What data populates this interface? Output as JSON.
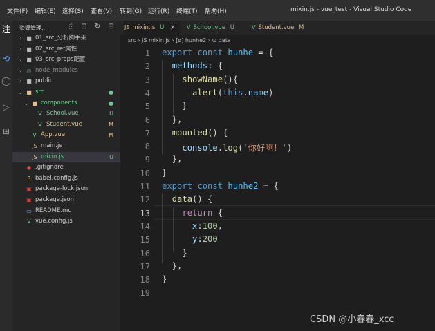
{
  "menu": [
    "文件(F)",
    "编辑(E)",
    "选择(S)",
    "查看(V)",
    "转到(G)",
    "运行(R)",
    "终端(T)",
    "帮助(H)"
  ],
  "window_title": "mixin.js - vue_test - Visual Studio Code",
  "activity": {
    "top_label": "注"
  },
  "sidebar": {
    "title": "资源管理...",
    "tools": "⎘ ⊡ ↻ ⊟ ···",
    "items": [
      {
        "label": "01_src_分析脚手架",
        "arrow": "›",
        "icon": "■",
        "status": ""
      },
      {
        "label": "02_src_ref属性",
        "arrow": "›",
        "icon": "■",
        "status": ""
      },
      {
        "label": "03_src_props配置",
        "arrow": "›",
        "icon": "■",
        "status": ""
      },
      {
        "label": "node_modules",
        "arrow": "›",
        "icon": "◎",
        "status": ""
      },
      {
        "label": "public",
        "arrow": "›",
        "icon": "■",
        "status": ""
      },
      {
        "label": "src",
        "arrow": "⌄",
        "icon": "■",
        "status": "●"
      },
      {
        "label": "components",
        "arrow": "⌄",
        "icon": "■",
        "status": "●"
      },
      {
        "label": "School.vue",
        "arrow": "",
        "icon": "V",
        "status": "U"
      },
      {
        "label": "Student.vue",
        "arrow": "",
        "icon": "V",
        "status": "M"
      },
      {
        "label": "App.vue",
        "arrow": "",
        "icon": "V",
        "status": "M"
      },
      {
        "label": "main.js",
        "arrow": "",
        "icon": "JS",
        "status": ""
      },
      {
        "label": "mixin.js",
        "arrow": "",
        "icon": "JS",
        "status": "U"
      },
      {
        "label": ".gitignore",
        "arrow": "",
        "icon": "◆",
        "status": ""
      },
      {
        "label": "babel.config.js",
        "arrow": "",
        "icon": "β",
        "status": ""
      },
      {
        "label": "package-lock.json",
        "arrow": "",
        "icon": "▣",
        "status": ""
      },
      {
        "label": "package.json",
        "arrow": "",
        "icon": "▣",
        "status": ""
      },
      {
        "label": "README.md",
        "arrow": "",
        "icon": "▭",
        "status": ""
      },
      {
        "label": "vue.config.js",
        "arrow": "",
        "icon": "V",
        "status": ""
      }
    ]
  },
  "tabs": [
    {
      "label": "mixin.js",
      "icon": "JS",
      "status": "U",
      "close": "×"
    },
    {
      "label": "School.vue",
      "icon": "V",
      "status": "U",
      "close": ""
    },
    {
      "label": "Student.vue",
      "icon": "V",
      "status": "M",
      "close": ""
    }
  ],
  "breadcrumb": "src  ›  JS mixin.js  ›  [ø] hunhe2  ›  ⊙ data",
  "code_lines": [
    [
      [
        "kb",
        "export "
      ],
      [
        "kb",
        "const "
      ],
      [
        "v",
        "hunhe"
      ],
      [
        "pun",
        " = {"
      ]
    ],
    [
      [
        "pun",
        "  "
      ],
      [
        "p",
        "methods"
      ],
      [
        "pun",
        ": {"
      ]
    ],
    [
      [
        "pun",
        "    "
      ],
      [
        "f",
        "showName"
      ],
      [
        "pun",
        "(){"
      ]
    ],
    [
      [
        "pun",
        "      "
      ],
      [
        "f",
        "alert"
      ],
      [
        "pun",
        "("
      ],
      [
        "kb",
        "this"
      ],
      [
        "pun",
        "."
      ],
      [
        "p",
        "name"
      ],
      [
        "pun",
        ")"
      ]
    ],
    [
      [
        "pun",
        "    }"
      ]
    ],
    [
      [
        "pun",
        "  },"
      ]
    ],
    [
      [
        "pun",
        "  "
      ],
      [
        "f",
        "mounted"
      ],
      [
        "pun",
        "() {"
      ]
    ],
    [
      [
        "pun",
        "    "
      ],
      [
        "p",
        "console"
      ],
      [
        "pun",
        "."
      ],
      [
        "f",
        "log"
      ],
      [
        "pun",
        "("
      ],
      [
        "s",
        "'你好啊！'"
      ],
      [
        "pun",
        ")"
      ]
    ],
    [
      [
        "pun",
        "  },"
      ]
    ],
    [
      [
        "pun",
        "}"
      ]
    ],
    [
      [
        "kb",
        "export "
      ],
      [
        "kb",
        "const "
      ],
      [
        "v",
        "hunhe2"
      ],
      [
        "pun",
        " = {"
      ]
    ],
    [
      [
        "pun",
        "  "
      ],
      [
        "f",
        "data"
      ],
      [
        "pun",
        "() {"
      ]
    ],
    [
      [
        "pun",
        "    "
      ],
      [
        "k",
        "return "
      ],
      [
        "pun",
        "{"
      ]
    ],
    [
      [
        "pun",
        "      "
      ],
      [
        "p",
        "x"
      ],
      [
        "pun",
        ":"
      ],
      [
        "n",
        "100"
      ],
      [
        "pun",
        ","
      ]
    ],
    [
      [
        "pun",
        "      "
      ],
      [
        "p",
        "y"
      ],
      [
        "pun",
        ":"
      ],
      [
        "n",
        "200"
      ]
    ],
    [
      [
        "pun",
        "    }"
      ]
    ],
    [
      [
        "pun",
        "  },"
      ]
    ],
    [
      [
        "pun",
        "}"
      ]
    ],
    [
      [
        "pun",
        ""
      ]
    ]
  ],
  "watermark": "CSDN @小春春_xcc"
}
